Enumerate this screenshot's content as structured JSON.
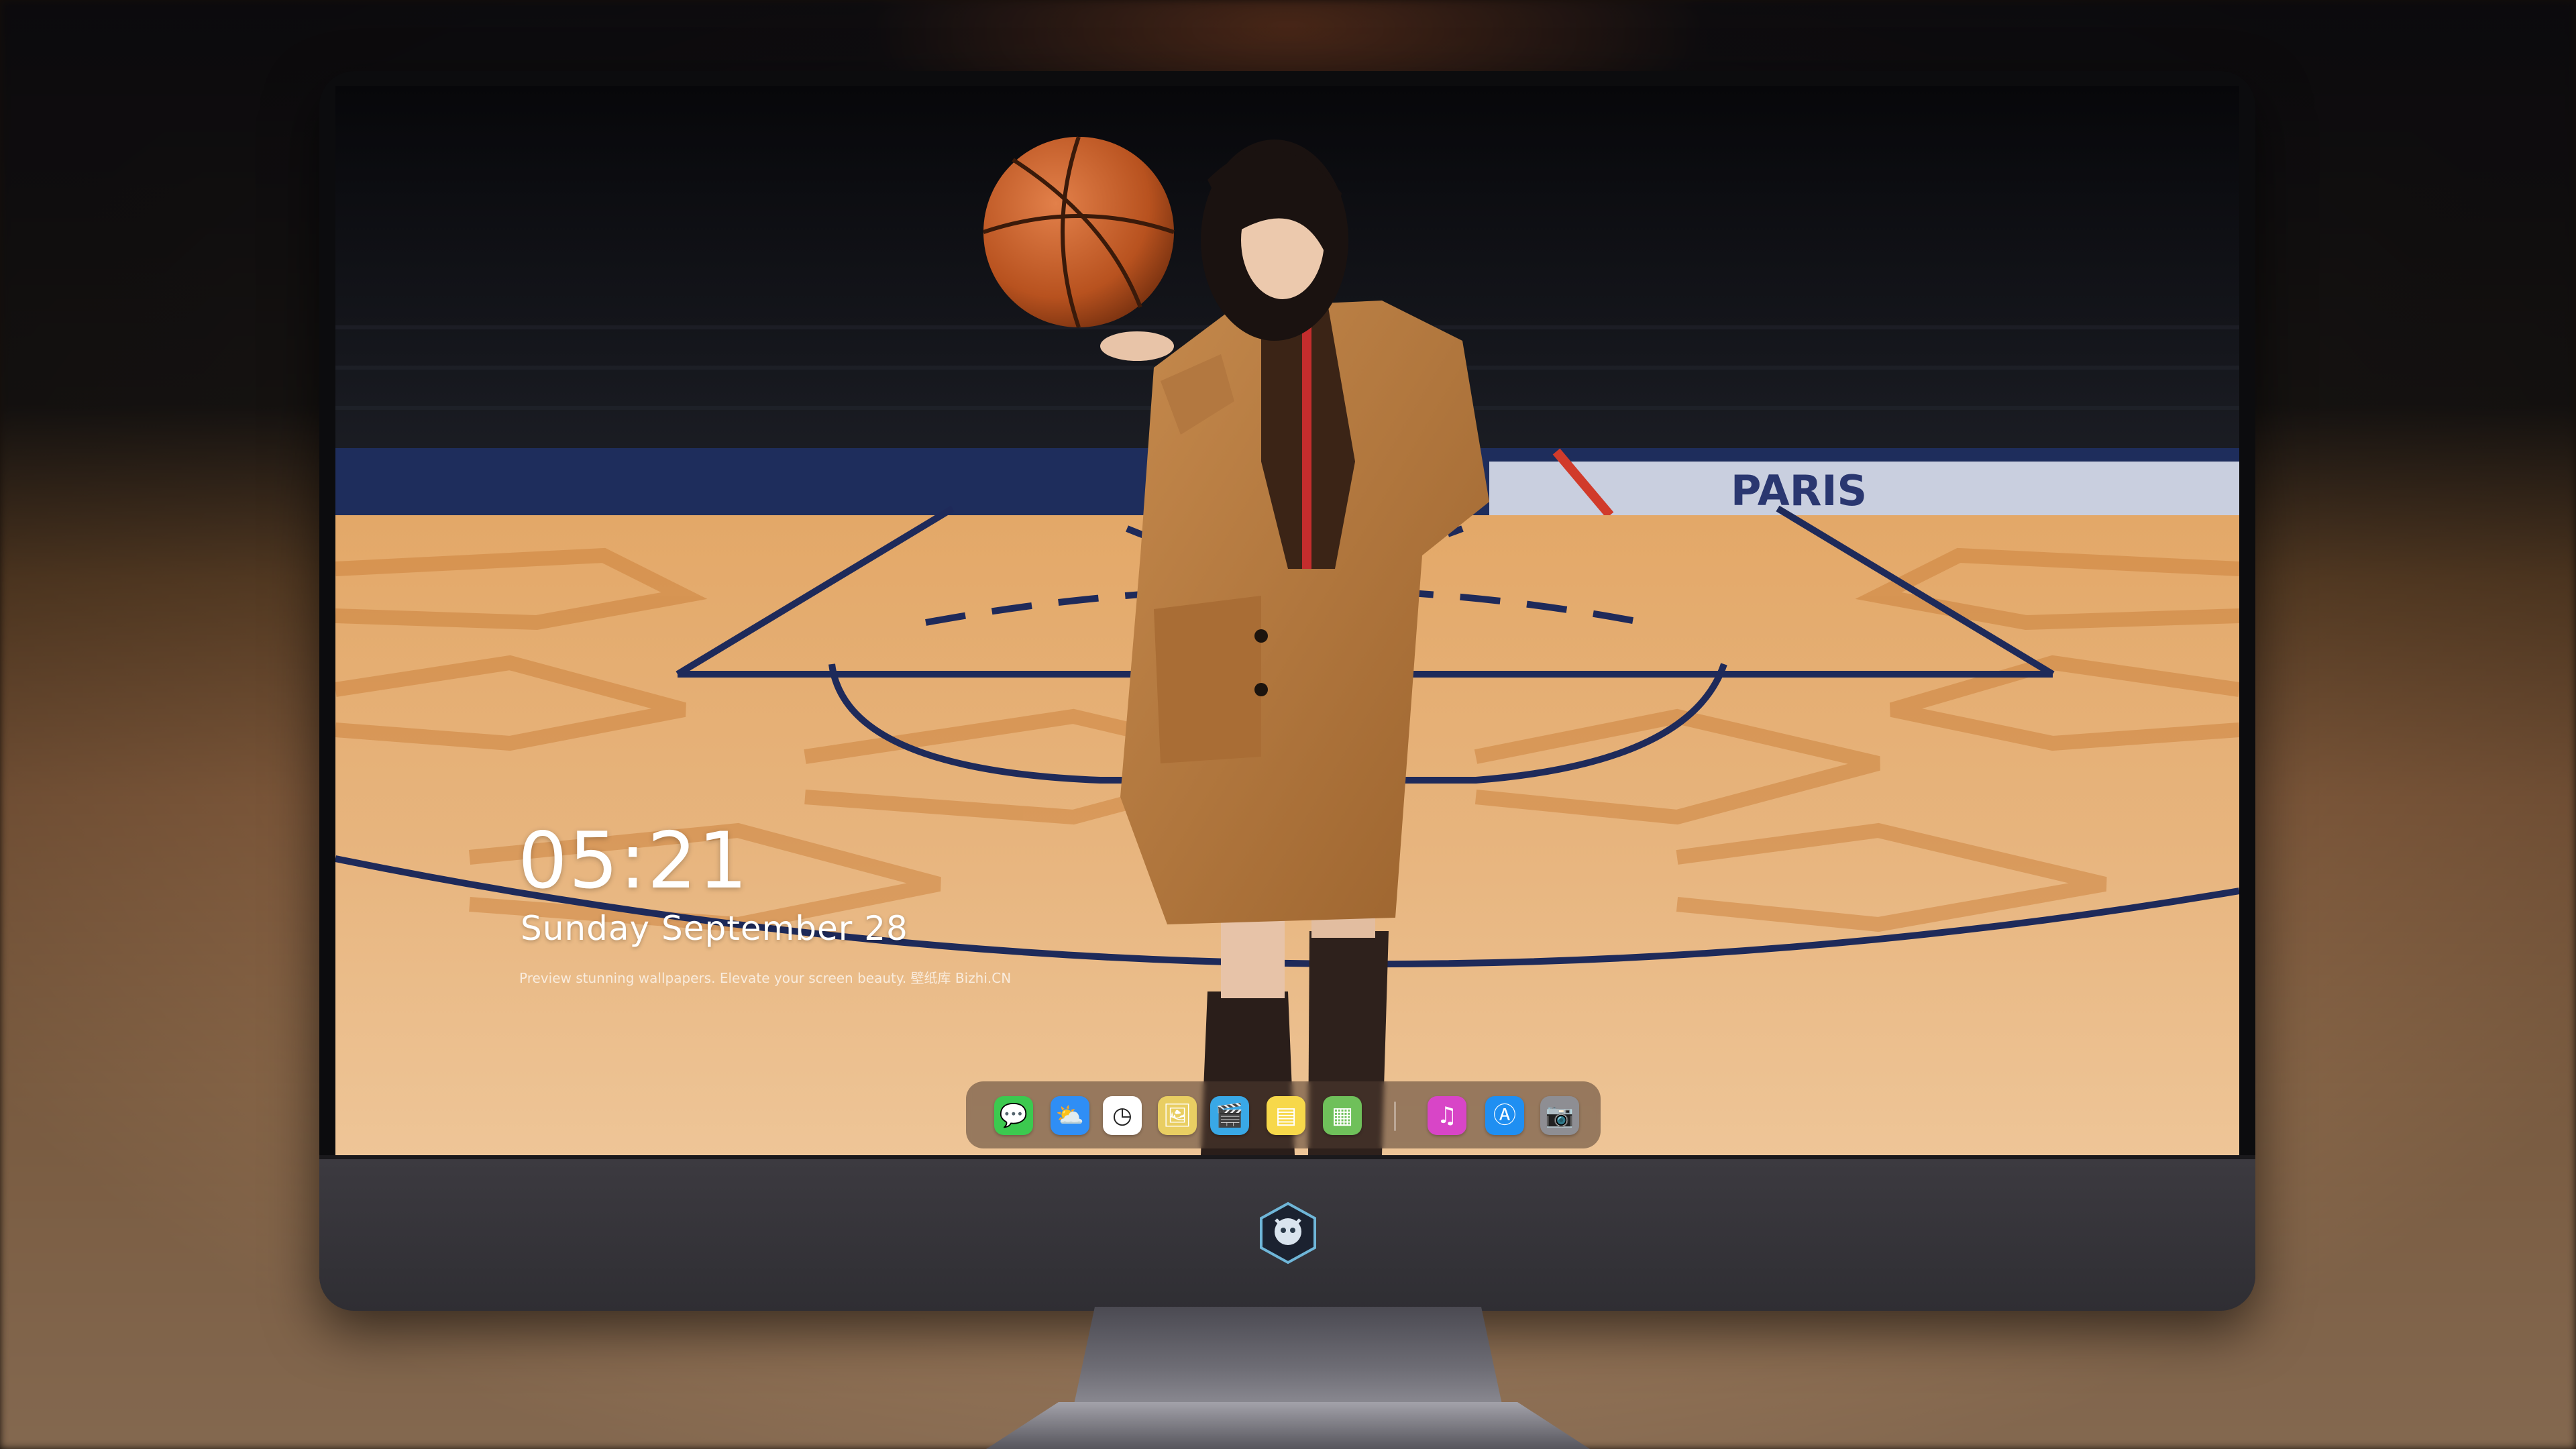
{
  "lockscreen": {
    "time": "05:21",
    "date": "Sunday September  28",
    "caption": "Preview stunning wallpapers. Elevate your screen beauty. 壁纸库 Bizhi.CN"
  },
  "wallpaper": {
    "court_text": "PARIS",
    "colors": {
      "floor_light": "#e6b27a",
      "floor_dark": "#c47a33",
      "court_line": "#1e2a5a",
      "coat": "#b0763e"
    }
  },
  "dock": {
    "items": [
      {
        "name": "messages-icon",
        "glyph": "💬",
        "color": "#3cc94f"
      },
      {
        "name": "weather-icon",
        "glyph": "⛅",
        "color": "#2f8ef5"
      },
      {
        "name": "clock-icon",
        "glyph": "◷",
        "color": "#ffffff"
      },
      {
        "name": "preview-icon",
        "glyph": "🖼",
        "color": "#e9ce62"
      },
      {
        "name": "clips-icon",
        "glyph": "🎬",
        "color": "#39a8e6"
      },
      {
        "name": "notes-icon",
        "glyph": "▤",
        "color": "#f7d84a"
      },
      {
        "name": "photo-app-icon",
        "glyph": "▦",
        "color": "#6fc05a"
      },
      {
        "name": "music-icon",
        "glyph": "♫",
        "color": "#d845c7"
      },
      {
        "name": "app-store-icon",
        "glyph": "Ⓐ",
        "color": "#1f8ff2"
      },
      {
        "name": "camera-icon",
        "glyph": "📷",
        "color": "#8e8e93"
      }
    ]
  }
}
